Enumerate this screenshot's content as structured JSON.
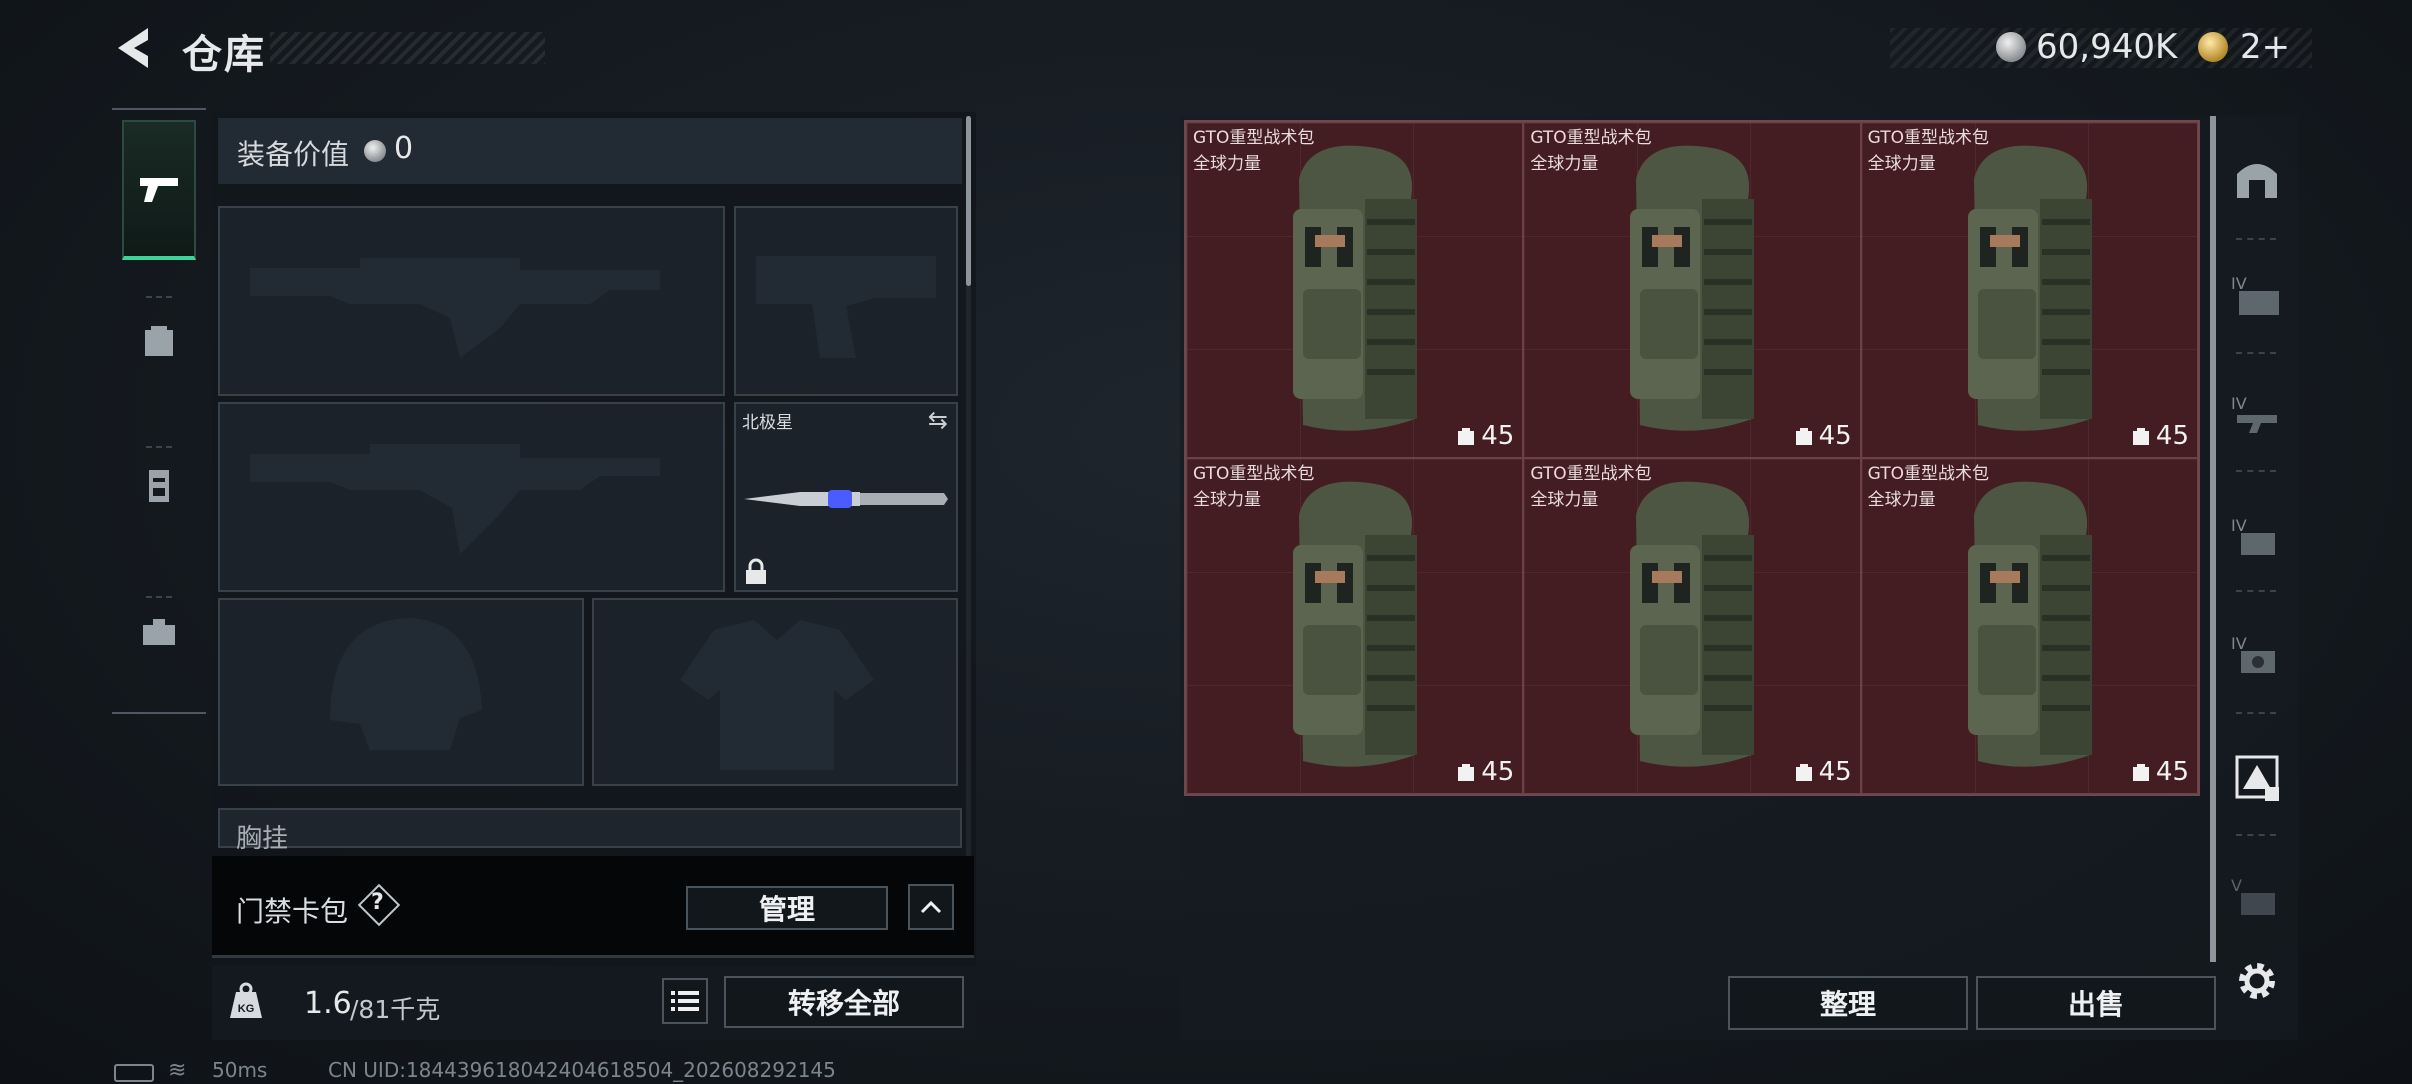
{
  "header": {
    "title": "仓库",
    "back_icon": "chevron-left-icon"
  },
  "currency": {
    "silver_value": "60,940K",
    "gold_value": "2+"
  },
  "rail": {
    "tabs": [
      "pistol-icon",
      "backpack-icon",
      "vest-icon",
      "toolbox-icon"
    ]
  },
  "equipment": {
    "value_label": "装备价值",
    "value": "0",
    "melee_name": "北极星",
    "chest_label": "胸挂"
  },
  "keycard": {
    "label": "门禁卡包",
    "help": "?",
    "manage_label": "管理"
  },
  "weight": {
    "current": "1.6",
    "total": "/81千克",
    "transfer_label": "转移全部"
  },
  "stash": {
    "items": [
      {
        "name": "GTO重型战术包",
        "sub": "全球力量",
        "count": "45"
      },
      {
        "name": "GTO重型战术包",
        "sub": "全球力量",
        "count": "45"
      },
      {
        "name": "GTO重型战术包",
        "sub": "全球力量",
        "count": "45"
      },
      {
        "name": "GTO重型战术包",
        "sub": "全球力量",
        "count": "45"
      },
      {
        "name": "GTO重型战术包",
        "sub": "全球力量",
        "count": "45"
      },
      {
        "name": "GTO重型战术包",
        "sub": "全球力量",
        "count": "45"
      }
    ],
    "tidy_label": "整理",
    "sell_label": "出售"
  },
  "status": {
    "ping": "50ms",
    "uid": "CN UID:18443961804240461850​4_202608292145"
  },
  "colors": {
    "active_tab": "#3fd39a",
    "stash_item_bg": "#431d22"
  }
}
